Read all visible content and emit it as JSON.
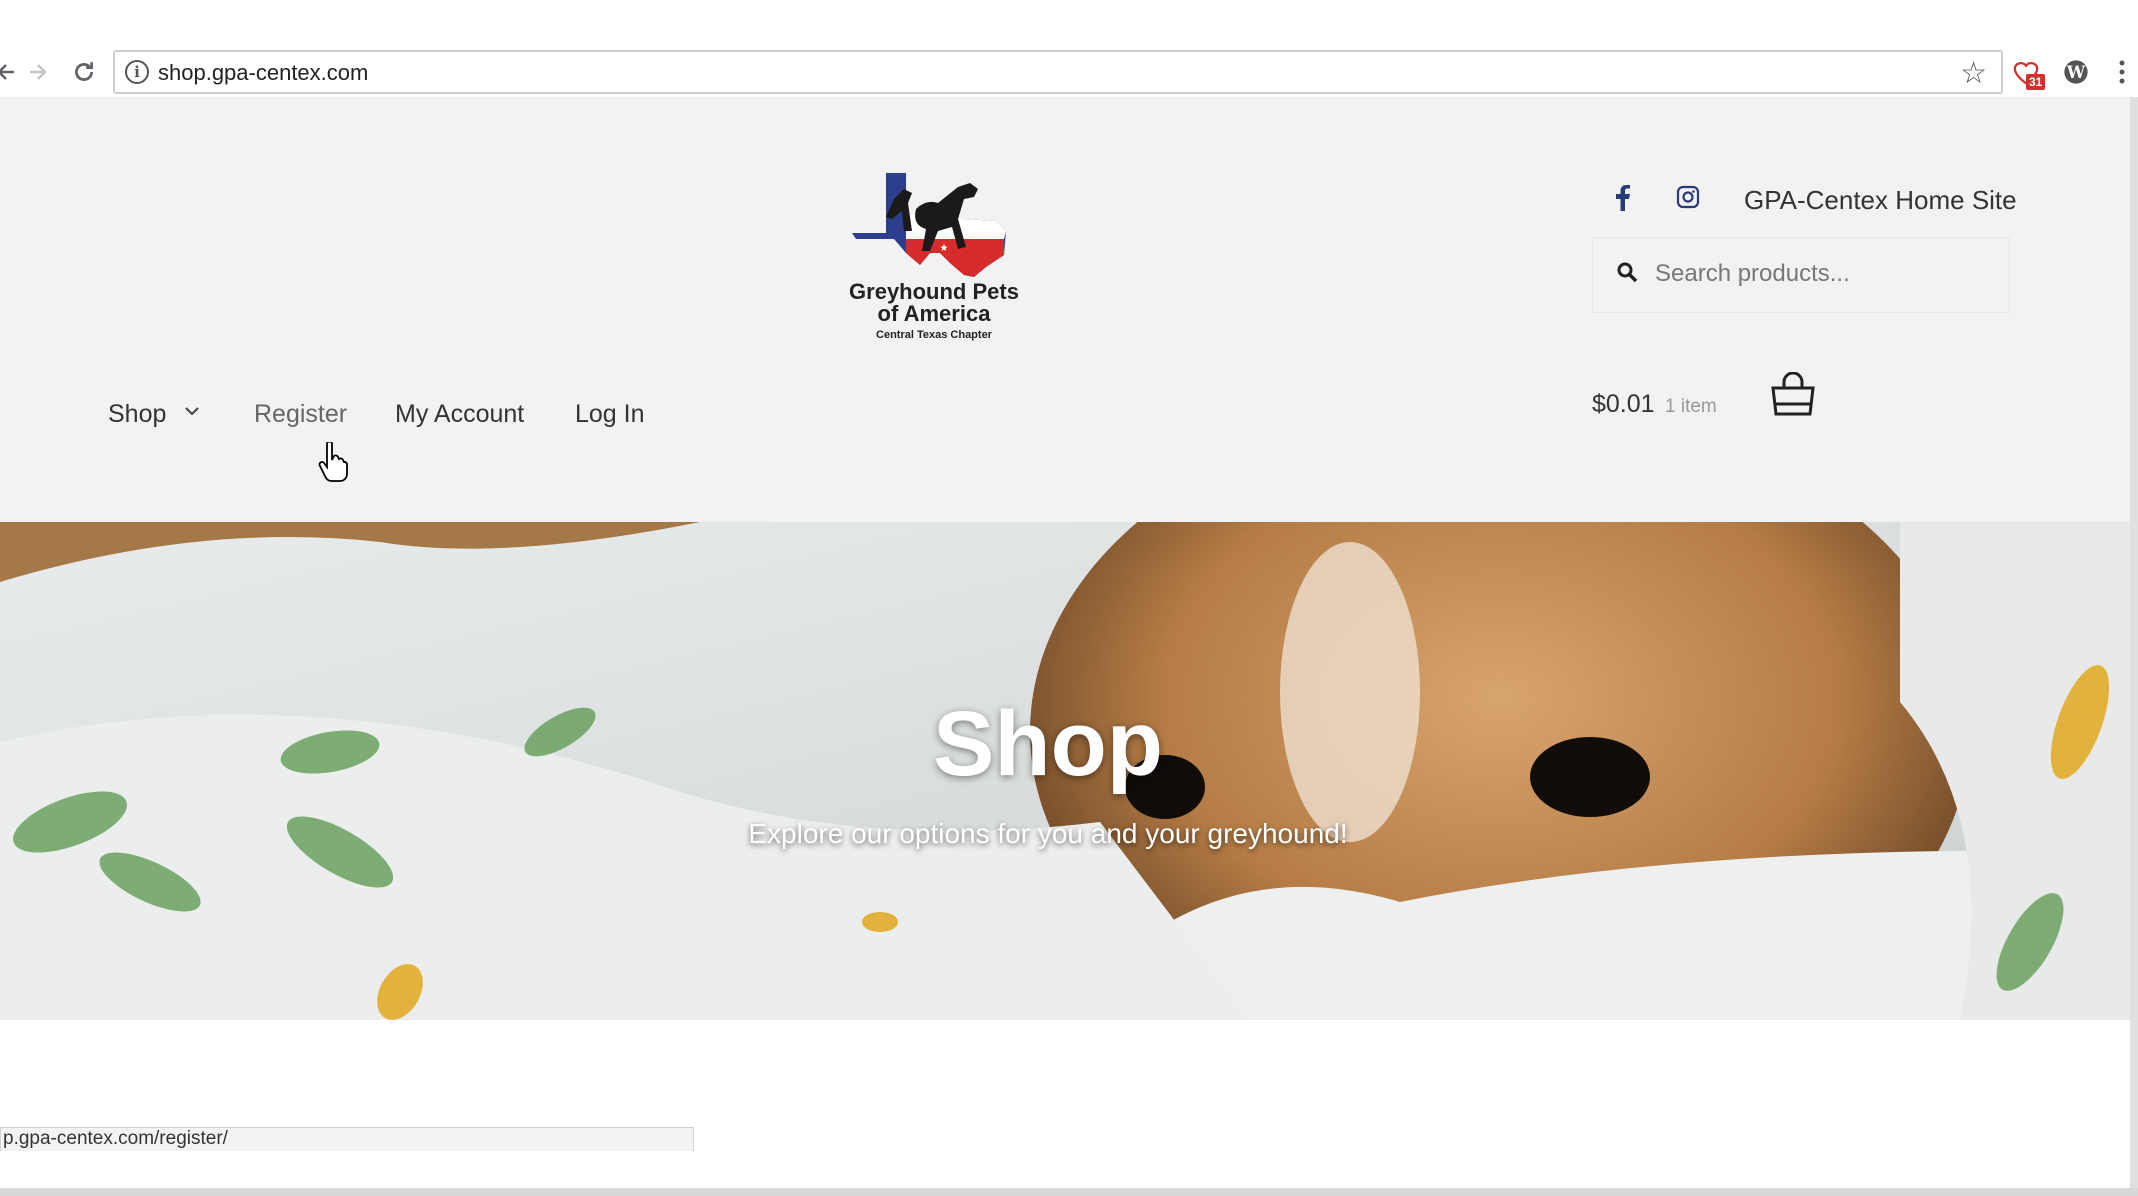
{
  "browser": {
    "url": "shop.gpa-centex.com",
    "extension_badge": "31",
    "status_url": "p.gpa-centex.com/register/"
  },
  "logo": {
    "line1": "Greyhound Pets",
    "line2": "of America",
    "line3": "Central Texas Chapter"
  },
  "header": {
    "home_link": "GPA-Centex Home Site",
    "search_placeholder": "Search products..."
  },
  "menu": {
    "shop": "Shop",
    "register": "Register",
    "my_account": "My Account",
    "log_in": "Log In"
  },
  "cart": {
    "total": "$0.01",
    "count": "1 item"
  },
  "hero": {
    "title": "Shop",
    "subtitle": "Explore our options for you and your greyhound!"
  },
  "colors": {
    "header_bg": "#f2f2f2",
    "social_icon": "#2b3a78"
  }
}
